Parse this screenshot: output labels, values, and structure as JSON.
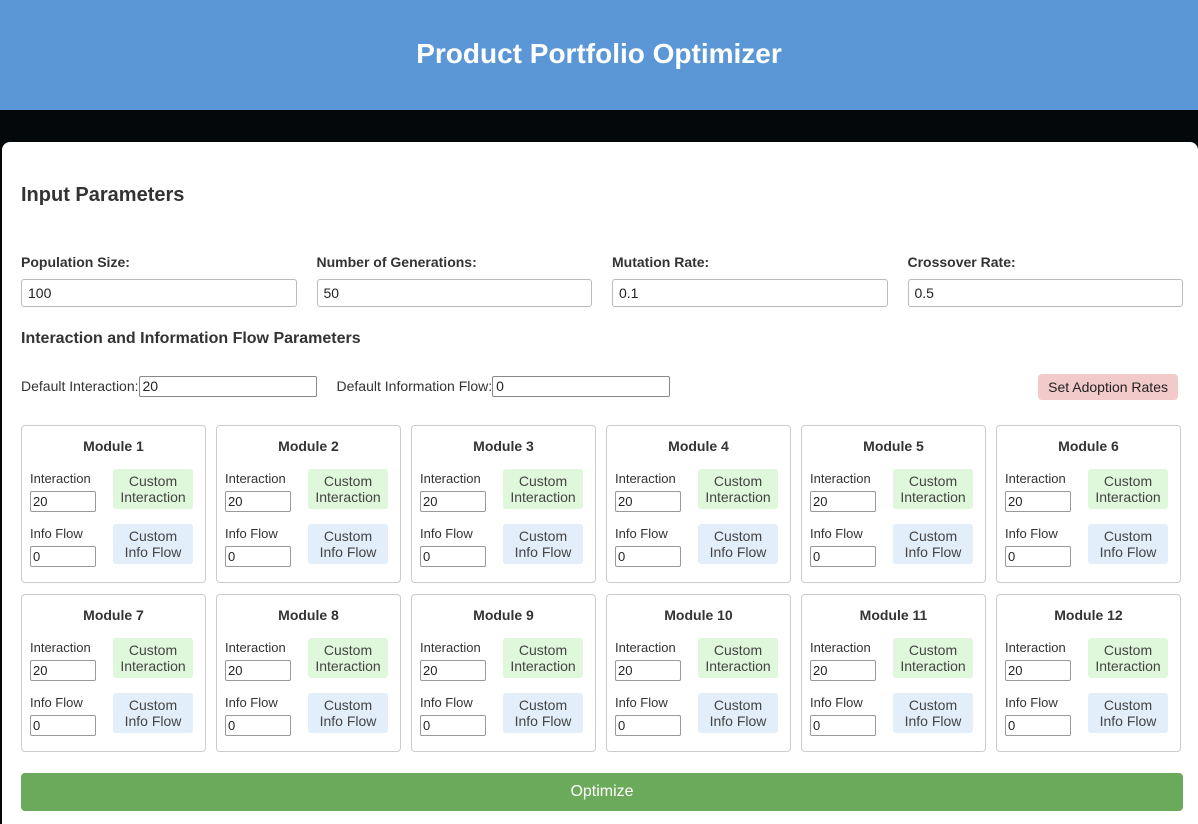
{
  "header": {
    "title": "Product Portfolio Optimizer"
  },
  "input_section": {
    "title": "Input Parameters"
  },
  "params": [
    {
      "label": "Population Size:",
      "value": "100"
    },
    {
      "label": "Number of Generations:",
      "value": "50"
    },
    {
      "label": "Mutation Rate:",
      "value": "0.1"
    },
    {
      "label": "Crossover Rate:",
      "value": "0.5"
    }
  ],
  "flow_section": {
    "title": "Interaction and Information Flow Parameters",
    "default_interaction_label": "Default Interaction:",
    "default_interaction_value": "20",
    "default_info_flow_label": "Default Information Flow:",
    "default_info_flow_value": "0",
    "adoption_button": "Set Adoption Rates"
  },
  "module_labels": {
    "interaction": "Interaction",
    "info_flow": "Info Flow",
    "custom_interaction": "Custom Interaction",
    "custom_info_flow": "Custom Info Flow"
  },
  "modules": [
    {
      "name": "Module 1",
      "interaction": "20",
      "info_flow": "0"
    },
    {
      "name": "Module 2",
      "interaction": "20",
      "info_flow": "0"
    },
    {
      "name": "Module 3",
      "interaction": "20",
      "info_flow": "0"
    },
    {
      "name": "Module 4",
      "interaction": "20",
      "info_flow": "0"
    },
    {
      "name": "Module 5",
      "interaction": "20",
      "info_flow": "0"
    },
    {
      "name": "Module 6",
      "interaction": "20",
      "info_flow": "0"
    },
    {
      "name": "Module 7",
      "interaction": "20",
      "info_flow": "0"
    },
    {
      "name": "Module 8",
      "interaction": "20",
      "info_flow": "0"
    },
    {
      "name": "Module 9",
      "interaction": "20",
      "info_flow": "0"
    },
    {
      "name": "Module 10",
      "interaction": "20",
      "info_flow": "0"
    },
    {
      "name": "Module 11",
      "interaction": "20",
      "info_flow": "0"
    },
    {
      "name": "Module 12",
      "interaction": "20",
      "info_flow": "0"
    }
  ],
  "optimize_button": "Optimize",
  "colors": {
    "header": "#5b97d6",
    "optimize": "#6aaa5a",
    "adoption": "#f2caca",
    "custom_interaction": "#dff7da",
    "custom_info_flow": "#e3eefb"
  }
}
